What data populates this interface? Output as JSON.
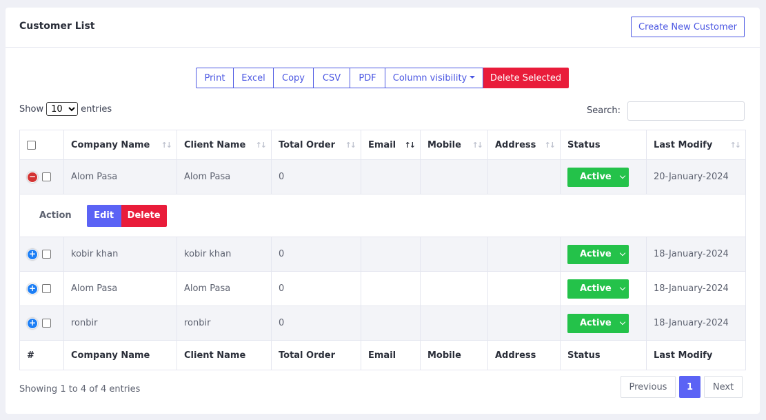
{
  "header": {
    "title": "Customer List",
    "create_label": "Create New Customer"
  },
  "toolbar": {
    "buttons": [
      "Print",
      "Excel",
      "Copy",
      "CSV",
      "PDF",
      "Column visibility",
      "Delete Selected"
    ]
  },
  "length": {
    "show": "Show",
    "value": "10",
    "entries": "entries"
  },
  "search": {
    "label": "Search:",
    "value": ""
  },
  "table": {
    "headers": [
      "Company Name",
      "Client Name",
      "Total Order",
      "Email",
      "Mobile",
      "Address",
      "Status",
      "Last Modify"
    ],
    "footers": [
      "#",
      "Company Name",
      "Client Name",
      "Total Order",
      "Email",
      "Mobile",
      "Address",
      "Status",
      "Last Modify"
    ],
    "rows": [
      {
        "company": "Alom Pasa",
        "client": "Alom Pasa",
        "total": "0",
        "email": "",
        "mobile": "",
        "address": "",
        "status": "Active",
        "modified": "20-January-2024",
        "expanded": true
      },
      {
        "company": "kobir khan",
        "client": "kobir khan",
        "total": "0",
        "email": "",
        "mobile": "",
        "address": "",
        "status": "Active",
        "modified": "18-January-2024",
        "expanded": false
      },
      {
        "company": "Alom Pasa",
        "client": "Alom Pasa",
        "total": "0",
        "email": "",
        "mobile": "",
        "address": "",
        "status": "Active",
        "modified": "18-January-2024",
        "expanded": false
      },
      {
        "company": "ronbir",
        "client": "ronbir",
        "total": "0",
        "email": "",
        "mobile": "",
        "address": "",
        "status": "Active",
        "modified": "18-January-2024",
        "expanded": false
      }
    ],
    "child": {
      "label": "Action",
      "edit": "Edit",
      "delete": "Delete"
    }
  },
  "info": "Showing 1 to 4 of 4 entries",
  "pagination": {
    "prev": "Previous",
    "current": "1",
    "next": "Next"
  },
  "colors": {
    "primary": "#4a56e2",
    "danger": "#e91c3a",
    "success": "#24c24a",
    "expand": "#1c7ef5",
    "collapse": "#d33333"
  }
}
